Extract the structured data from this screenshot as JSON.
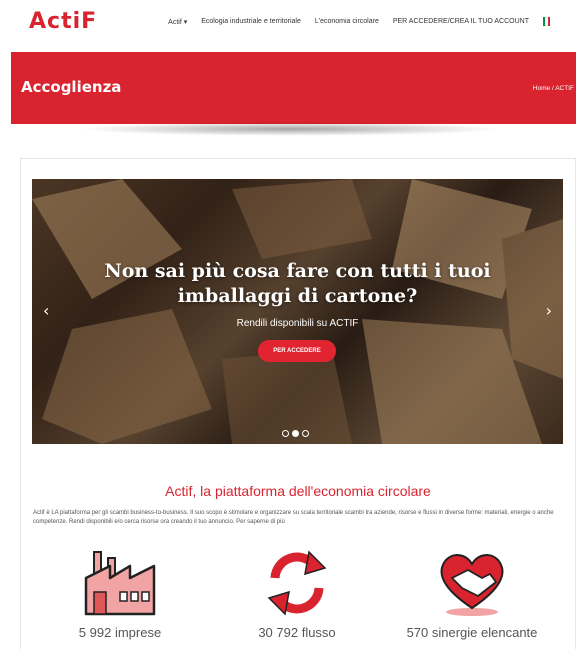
{
  "header": {
    "logo": "ActiF",
    "nav": [
      "Actif ▾",
      "Ecologia industriale e territoriale",
      "L'economia circolare",
      "PER ACCEDERE/CREA IL TUO ACCOUNT"
    ]
  },
  "banner": {
    "title": "Accoglienza",
    "breadcrumb": "Home /  ACTIF"
  },
  "slider": {
    "title_line1": "Non sai più cosa fare con tutti i tuoi",
    "title_line2": "imballaggi di cartone?",
    "subtitle": "Rendili disponibili su ACTIF",
    "button": "PER ACCEDERE",
    "prev": "‹",
    "next": "›"
  },
  "intro": {
    "title": "Actif, la piattaforma dell'economia circolare",
    "text": "Actif è LA piattaforma per gli scambi business-to-business. Il suo scopo è stimolare e organizzare su scala territoriale scambi tra aziende, risorse e flussi in diverse forme: materiali, energie o anche competenze. Rendi disponibili e/o cerca risorse ora creando il tuo annuncio. Per saperne di più"
  },
  "stats": [
    {
      "label": "5 992 imprese",
      "icon": "factory-icon"
    },
    {
      "label": "30 792 flusso",
      "icon": "recycle-arrows-icon"
    },
    {
      "label": "570 sinergie elencante",
      "icon": "handshake-heart-icon"
    }
  ],
  "colors": {
    "brand": "#d9242f",
    "flag": [
      "#009246",
      "#ffffff",
      "#ce2b37"
    ]
  }
}
